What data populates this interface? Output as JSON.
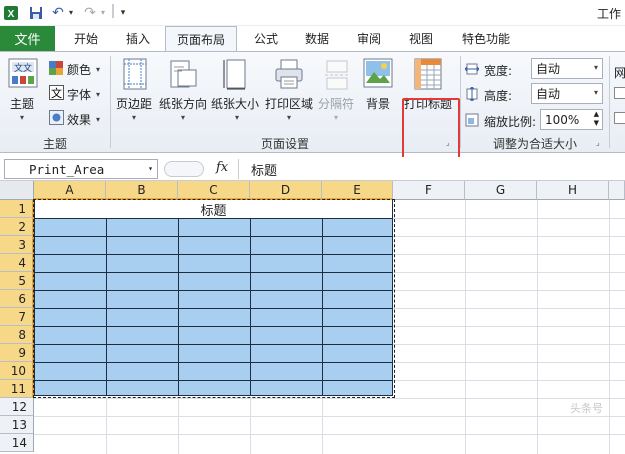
{
  "app": {
    "title": "工作"
  },
  "qat": {
    "undo_icon": "undo-icon",
    "redo_icon": "redo-icon",
    "save_icon": "save-icon"
  },
  "tabs": {
    "file": "文件",
    "items": [
      "开始",
      "插入",
      "页面布局",
      "公式",
      "数据",
      "审阅",
      "视图",
      "特色功能"
    ],
    "active": "页面布局"
  },
  "ribbon": {
    "theme_group": {
      "label": "主题",
      "theme_button": "主题",
      "colors": "颜色",
      "fonts": "字体",
      "effects": "效果"
    },
    "page_setup_group": {
      "label": "页面设置",
      "margins": "页边距",
      "orientation": "纸张方向",
      "size": "纸张大小",
      "print_area": "打印区域",
      "breaks": "分隔符",
      "background": "背景",
      "print_titles": "打印标题"
    },
    "scale_group": {
      "label": "调整为合适大小",
      "width_label": "宽度:",
      "width_value": "自动",
      "height_label": "高度:",
      "height_value": "自动",
      "scale_label": "缩放比例:",
      "scale_value": "100%"
    },
    "sheet_options_partial": "网"
  },
  "formula_bar": {
    "name_box": "Print_Area",
    "fx": "fx",
    "content": "标题"
  },
  "sheet": {
    "columns": [
      "A",
      "B",
      "C",
      "D",
      "E",
      "F",
      "G",
      "H"
    ],
    "rows": [
      "1",
      "2",
      "3",
      "4",
      "5",
      "6",
      "7",
      "8",
      "9",
      "10",
      "11",
      "12",
      "13",
      "14"
    ],
    "title_cell": "标题",
    "watermark": "头条号"
  },
  "colors": {
    "file_tab": "#2a8a3a",
    "table_fill": "#a9cff0",
    "highlight": "#e23a3a",
    "selected_header": "#f7d889"
  }
}
